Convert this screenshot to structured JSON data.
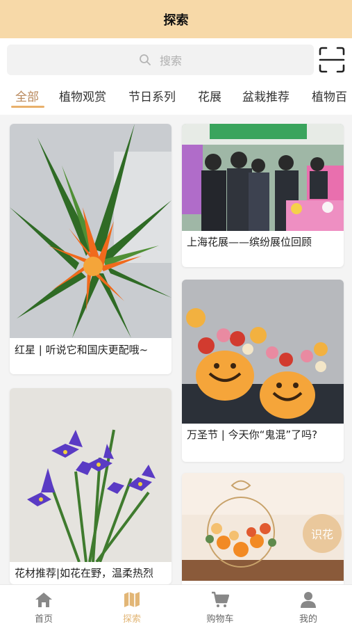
{
  "header": {
    "title": "探索"
  },
  "search": {
    "placeholder": "搜索",
    "icon": "search-icon",
    "scan_icon": "scan-icon"
  },
  "tabs": [
    {
      "label": "全部",
      "active": true
    },
    {
      "label": "植物观赏"
    },
    {
      "label": "节日系列"
    },
    {
      "label": "花展"
    },
    {
      "label": "盆栽推荐"
    },
    {
      "label": "植物百"
    }
  ],
  "cards": [
    {
      "title": "红星 | 听说它和国庆更配哦~"
    },
    {
      "title": "上海花展——缤纷展位回顾"
    },
    {
      "title": "万圣节 | 今天你“鬼混”了吗?"
    },
    {
      "title": "花材推荐|如花在野，温柔热烈"
    },
    {
      "title": ""
    }
  ],
  "float_button": {
    "label": "识花"
  },
  "tabbar": [
    {
      "label": "首页",
      "icon": "home-icon"
    },
    {
      "label": "探索",
      "icon": "map-icon",
      "active": true
    },
    {
      "label": "购物车",
      "icon": "cart-icon"
    },
    {
      "label": "我的",
      "icon": "user-icon"
    }
  ],
  "colors": {
    "accent": "#e2b676",
    "header_bg": "#f7d9a8",
    "active_tab": "#b8875a"
  }
}
